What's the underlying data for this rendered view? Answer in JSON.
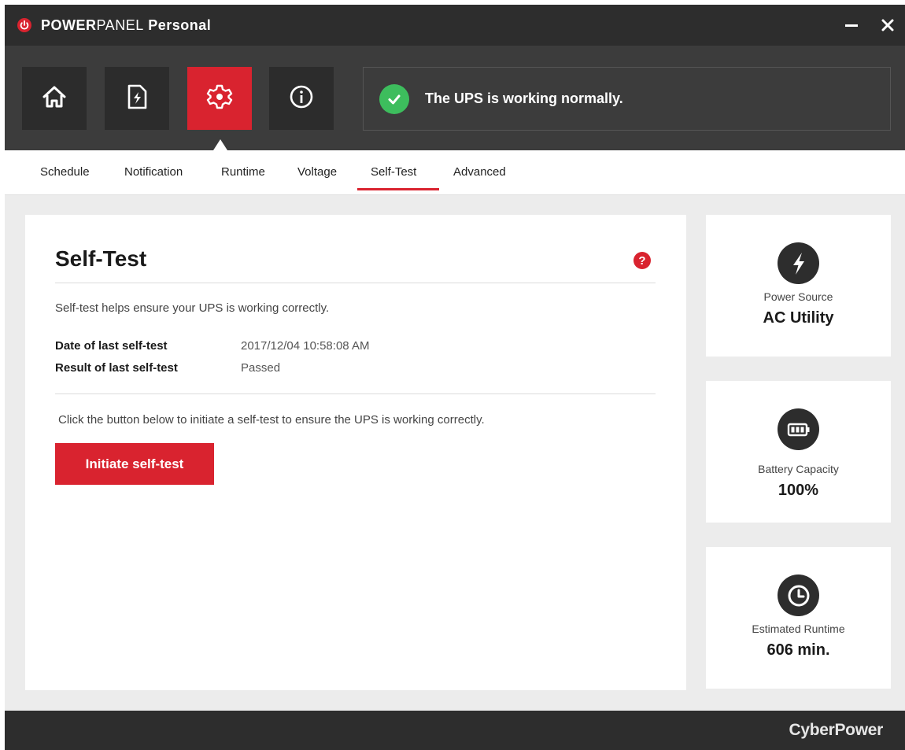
{
  "app": {
    "title_part1": "POWER",
    "title_part2": "PANEL",
    "title_part3": " Personal",
    "brand_color": "#d9232f"
  },
  "window_controls": {
    "minimize_icon": "minimize-icon",
    "close_icon": "close-icon"
  },
  "nav": {
    "items": [
      {
        "icon": "home-icon",
        "active": false
      },
      {
        "icon": "power-document-icon",
        "active": false
      },
      {
        "icon": "gear-icon",
        "active": true
      },
      {
        "icon": "info-icon",
        "active": false
      }
    ]
  },
  "status": {
    "text": "The UPS is working normally.",
    "icon": "check-circle-icon",
    "color": "#3dbd5d"
  },
  "tabs": [
    {
      "label": "Schedule"
    },
    {
      "label": "Notification"
    },
    {
      "label": "Runtime"
    },
    {
      "label": "Voltage"
    },
    {
      "label": "Self-Test",
      "active": true
    },
    {
      "label": "Advanced"
    }
  ],
  "selftest": {
    "title": "Self-Test",
    "description": "Self-test helps ensure your UPS is working correctly.",
    "date_label": "Date of last self-test",
    "date_value": "2017/12/04 10:58:08 AM",
    "result_label": "Result of last self-test",
    "result_value": "Passed",
    "instruction": "Click the button below to initiate a self-test to ensure the UPS is working correctly.",
    "button_label": "Initiate self-test",
    "help_icon": "?"
  },
  "cards": [
    {
      "icon": "lightning-icon",
      "label": "Power Source",
      "value": "AC Utility"
    },
    {
      "icon": "battery-icon",
      "label": "Battery Capacity",
      "value": "100%"
    },
    {
      "icon": "clock-icon",
      "label": "Estimated Runtime",
      "value": "606 min."
    }
  ],
  "footer": {
    "brand": "CyberPower"
  }
}
